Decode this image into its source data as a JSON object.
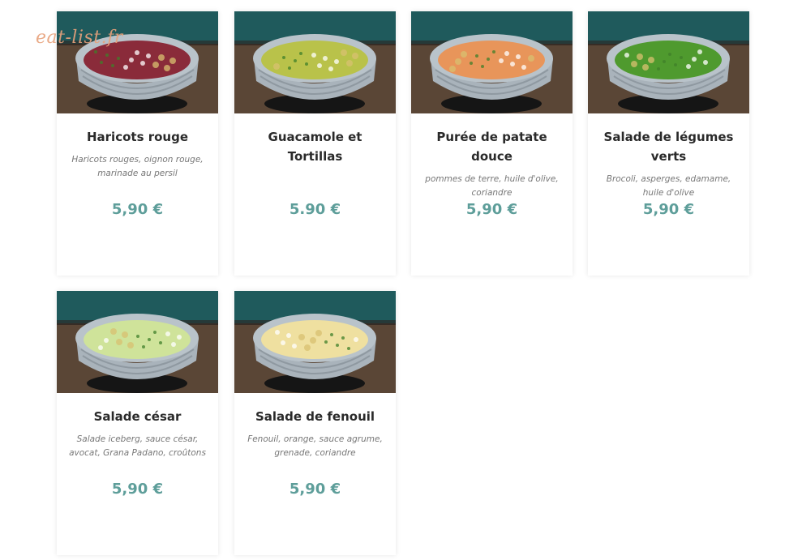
{
  "watermark": "eat-list.fr",
  "colors": {
    "price": "#5e9e9a",
    "title": "#2a2a2a",
    "description": "#777777"
  },
  "items": [
    {
      "name": "Haricots rouge",
      "description": "Haricots rouges, oignon rouge, marinade au persil",
      "price": "5,90 €",
      "photo_icon": "red-bean-bowl-icon",
      "food_color": "#8a2b3a"
    },
    {
      "name": "Guacamole et Tortillas",
      "description": "",
      "price": "5.90 €",
      "photo_icon": "guacamole-bowl-icon",
      "food_color": "#b9c24a"
    },
    {
      "name": "Purée de patate douce",
      "description": "pommes de terre, huile d'olive, coriandre",
      "price": "5,90 €",
      "photo_icon": "puree-bowl-icon",
      "food_color": "#e8955a"
    },
    {
      "name": "Salade de légumes verts",
      "description": "Brocoli, asperges, edamame, huile d'olive",
      "price": "5,90 €",
      "photo_icon": "green-salad-bowl-icon",
      "food_color": "#4f9a2e"
    },
    {
      "name": "Salade césar",
      "description": "Salade iceberg, sauce césar, avocat, Grana Padano, croûtons",
      "price": "5,90 €",
      "photo_icon": "caesar-salad-bowl-icon",
      "food_color": "#cfe39a"
    },
    {
      "name": "Salade de fenouil",
      "description": "Fenouil, orange, sauce agrume, grenade, coriandre",
      "price": "5,90 €",
      "photo_icon": "fennel-salad-bowl-icon",
      "food_color": "#efe0a0"
    }
  ]
}
